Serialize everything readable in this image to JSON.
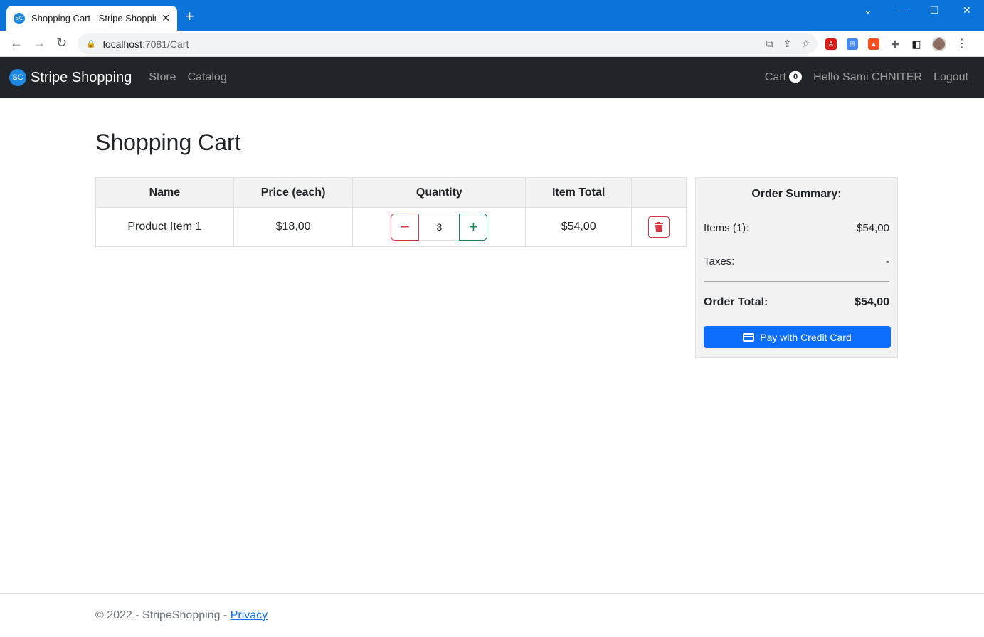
{
  "browser": {
    "tab_title": "Shopping Cart - Stripe Shopping",
    "tab_favicon": "SC",
    "url_host": "localhost",
    "url_path": ":7081/Cart"
  },
  "navbar": {
    "brand_logo": "SC",
    "brand_name": "Stripe Shopping",
    "links": [
      "Store",
      "Catalog"
    ],
    "cart_label": "Cart",
    "cart_count": "0",
    "greeting": "Hello Sami CHNITER",
    "logout_label": "Logout"
  },
  "page": {
    "title": "Shopping Cart"
  },
  "cart": {
    "headers": [
      "Name",
      "Price (each)",
      "Quantity",
      "Item Total",
      ""
    ],
    "items": [
      {
        "name": "Product Item 1",
        "price": "$18,00",
        "quantity": "3",
        "total": "$54,00"
      }
    ]
  },
  "summary": {
    "title": "Order Summary:",
    "items_label": "Items (1):",
    "items_value": "$54,00",
    "taxes_label": "Taxes:",
    "taxes_value": "-",
    "total_label": "Order Total:",
    "total_value": "$54,00",
    "pay_label": "Pay with Credit Card"
  },
  "footer": {
    "copyright": "© 2022 - StripeShopping - ",
    "privacy_label": "Privacy"
  },
  "colors": {
    "navbar_bg": "#212529",
    "primary": "#0d6efd",
    "danger": "#dc3545",
    "success": "#198754"
  }
}
